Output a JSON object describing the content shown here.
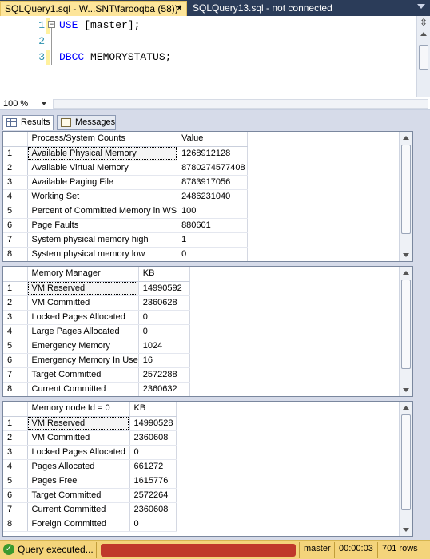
{
  "tabs": {
    "active_title": "SQLQuery1.sql - W...SNT\\farooqba (58))*",
    "active_close": "✕",
    "inactive_title": "SQLQuery13.sql - not connected"
  },
  "editor": {
    "lines": [
      {
        "num": "1",
        "code_kw": "USE",
        "code_rest": " [master];"
      },
      {
        "num": "2",
        "code_kw": "",
        "code_rest": ""
      },
      {
        "num": "3",
        "code_kw": "DBCC",
        "code_rest": " MEMORYSTATUS;"
      }
    ],
    "split_symbol": "⇳",
    "collapse_symbol": "−"
  },
  "zoom": {
    "value": "100 %"
  },
  "results_tabs": {
    "results": "Results",
    "messages": "Messages"
  },
  "grids": [
    {
      "headers": [
        "Process/System Counts",
        "Value"
      ],
      "rows": [
        [
          "1",
          "Available Physical Memory",
          "1268912128"
        ],
        [
          "2",
          "Available Virtual Memory",
          "8780274577408"
        ],
        [
          "3",
          "Available Paging File",
          "8783917056"
        ],
        [
          "4",
          "Working Set",
          "2486231040"
        ],
        [
          "5",
          "Percent of Committed Memory in WS",
          "100"
        ],
        [
          "6",
          "Page Faults",
          "880601"
        ],
        [
          "7",
          "System physical memory high",
          "1"
        ],
        [
          "8",
          "System physical memory low",
          "0"
        ]
      ]
    },
    {
      "headers": [
        "Memory Manager",
        "KB"
      ],
      "rows": [
        [
          "1",
          "VM Reserved",
          "14990592"
        ],
        [
          "2",
          "VM Committed",
          "2360628"
        ],
        [
          "3",
          "Locked Pages Allocated",
          "0"
        ],
        [
          "4",
          "Large Pages Allocated",
          "0"
        ],
        [
          "5",
          "Emergency Memory",
          "1024"
        ],
        [
          "6",
          "Emergency Memory In Use",
          "16"
        ],
        [
          "7",
          "Target Committed",
          "2572288"
        ],
        [
          "8",
          "Current Committed",
          "2360632"
        ]
      ]
    },
    {
      "headers": [
        "Memory node Id = 0",
        "KB"
      ],
      "rows": [
        [
          "1",
          "VM Reserved",
          "14990528"
        ],
        [
          "2",
          "VM Committed",
          "2360608"
        ],
        [
          "3",
          "Locked Pages Allocated",
          "0"
        ],
        [
          "4",
          "Pages Allocated",
          "661272"
        ],
        [
          "5",
          "Pages Free",
          "1615776"
        ],
        [
          "6",
          "Target Committed",
          "2572264"
        ],
        [
          "7",
          "Current Committed",
          "2360608"
        ],
        [
          "8",
          "Foreign Committed",
          "0"
        ]
      ]
    }
  ],
  "status": {
    "icon": "✓",
    "message": "Query executed...",
    "database": "master",
    "elapsed": "00:00:03",
    "rows": "701 rows"
  }
}
